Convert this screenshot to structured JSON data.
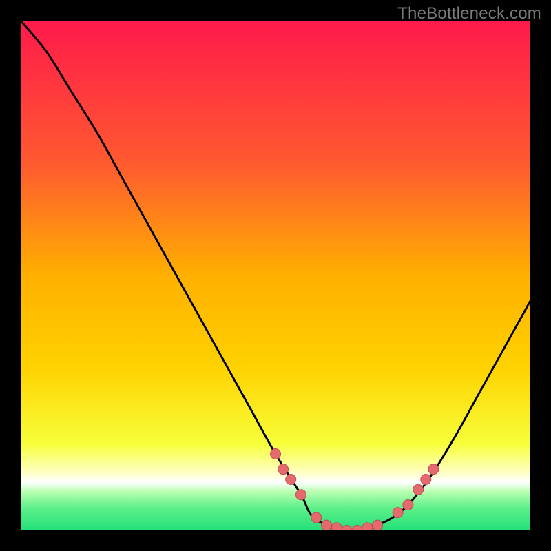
{
  "watermark": "TheBottleneck.com",
  "colors": {
    "bg": "#000000",
    "gradient_top": "#ff1a4b",
    "gradient_mid_upper": "#ff7a28",
    "gradient_mid": "#ffd200",
    "gradient_lower": "#f7ff3a",
    "gradient_band_pale": "#ffffc0",
    "gradient_green_light": "#b6ffb0",
    "gradient_green": "#22e07a",
    "curve": "#000000",
    "dot_fill": "#e46a6e",
    "dot_stroke": "#c24a52"
  },
  "chart_data": {
    "type": "line",
    "title": "",
    "xlabel": "",
    "ylabel": "",
    "xlim": [
      0,
      100
    ],
    "ylim": [
      0,
      100
    ],
    "series": [
      {
        "name": "bottleneck-curve",
        "x": [
          0,
          5,
          10,
          15,
          20,
          25,
          30,
          35,
          40,
          45,
          50,
          55,
          57,
          60,
          63,
          66,
          70,
          75,
          80,
          85,
          90,
          95,
          100
        ],
        "y": [
          100,
          94,
          86,
          78,
          69,
          60,
          51,
          42,
          33,
          24,
          15,
          7,
          3,
          1,
          0,
          0,
          1,
          4,
          10,
          18,
          27,
          36,
          45
        ]
      }
    ],
    "scatter_points": {
      "name": "highlight-dots",
      "x": [
        50,
        51.5,
        53,
        55,
        58,
        60,
        62,
        64,
        66,
        68,
        70,
        74,
        76,
        78,
        79.5,
        81
      ],
      "y": [
        15,
        12,
        10,
        7,
        2.5,
        1,
        0.5,
        0,
        0,
        0.5,
        1,
        3.5,
        5,
        8,
        10,
        12
      ]
    }
  }
}
